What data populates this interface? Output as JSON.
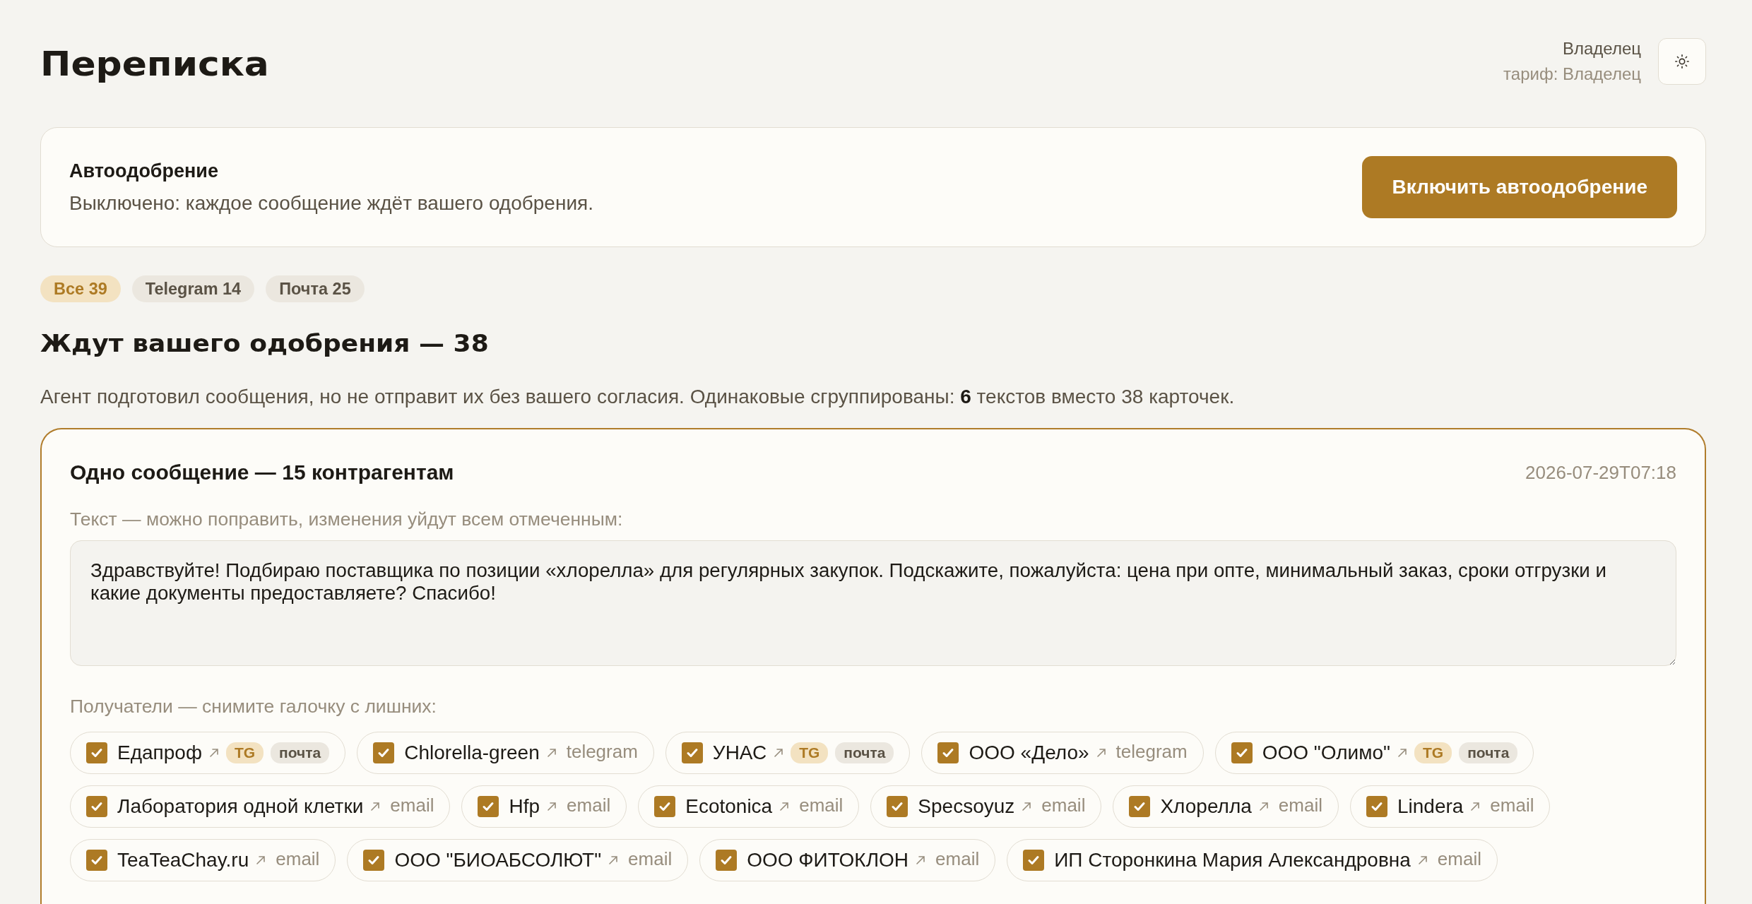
{
  "page": {
    "title": "Переписка"
  },
  "user": {
    "name": "Владелец",
    "plan": "тариф: Владелец"
  },
  "autoapprove": {
    "title": "Автоодобрение",
    "status": "Выключено: каждое сообщение ждёт вашего одобрения.",
    "button": "Включить автоодобрение"
  },
  "filters": [
    {
      "label": "Все 39",
      "selected": true
    },
    {
      "label": "Telegram 14",
      "selected": false
    },
    {
      "label": "Почта 25",
      "selected": false
    }
  ],
  "section": {
    "title": "Ждут вашего одобрения — 38",
    "description": "Агент подготовил сообщения, но не отправит их без вашего согласия. Одинаковые сгруппированы: **6** текстов вместо 38 карточек."
  },
  "group": {
    "title": "Одно сообщение — 15 контрагентам",
    "time": "2026-07-29T07:18",
    "text_label": "Текст — можно поправить, изменения уйдут всем отмеченным:",
    "text": "Здравствуйте! Подбираю поставщика по позиции «хлорелла» для регулярных закупок. Подскажите, пожалуйста: цена при опте, минимальный заказ, сроки отгрузки и какие документы предоставляете? Спасибо!",
    "recipients_label": "Получатели — снимите галочку с лишних:",
    "recipients": [
      {
        "name": "Едапроф",
        "checked": true,
        "tags": [
          {
            "kind": "tg",
            "label": "TG"
          },
          {
            "kind": "mail",
            "label": "почта"
          }
        ]
      },
      {
        "name": "Chlorella-green",
        "checked": true,
        "tags": [
          {
            "kind": "plain",
            "label": "telegram"
          }
        ]
      },
      {
        "name": "УНАС",
        "checked": true,
        "tags": [
          {
            "kind": "tg",
            "label": "TG"
          },
          {
            "kind": "mail",
            "label": "почта"
          }
        ]
      },
      {
        "name": "ООО «Дело»",
        "checked": true,
        "tags": [
          {
            "kind": "plain",
            "label": "telegram"
          }
        ]
      },
      {
        "name": "ООО \"Олимо\"",
        "checked": true,
        "tags": [
          {
            "kind": "tg",
            "label": "TG"
          },
          {
            "kind": "mail",
            "label": "почта"
          }
        ]
      },
      {
        "name": "Лаборатория одной клетки",
        "checked": true,
        "tags": [
          {
            "kind": "plain",
            "label": "email"
          }
        ]
      },
      {
        "name": "Hfp",
        "checked": true,
        "tags": [
          {
            "kind": "plain",
            "label": "email"
          }
        ]
      },
      {
        "name": "Ecotonica",
        "checked": true,
        "tags": [
          {
            "kind": "plain",
            "label": "email"
          }
        ]
      },
      {
        "name": "Specsoyuz",
        "checked": true,
        "tags": [
          {
            "kind": "plain",
            "label": "email"
          }
        ]
      },
      {
        "name": "Хлорелла",
        "checked": true,
        "tags": [
          {
            "kind": "plain",
            "label": "email"
          }
        ]
      },
      {
        "name": "Lindera",
        "checked": true,
        "tags": [
          {
            "kind": "plain",
            "label": "email"
          }
        ]
      },
      {
        "name": "TeaTeaChay.ru",
        "checked": true,
        "tags": [
          {
            "kind": "plain",
            "label": "email"
          }
        ]
      },
      {
        "name": "ООО \"БИОАБСОЛЮТ\"",
        "checked": true,
        "tags": [
          {
            "kind": "plain",
            "label": "email"
          }
        ]
      },
      {
        "name": "ООО ФИТОКЛОН",
        "checked": true,
        "tags": [
          {
            "kind": "plain",
            "label": "email"
          }
        ]
      },
      {
        "name": "ИП Сторонкина Мария Александровна",
        "checked": true,
        "tags": [
          {
            "kind": "plain",
            "label": "email"
          }
        ]
      }
    ]
  }
}
